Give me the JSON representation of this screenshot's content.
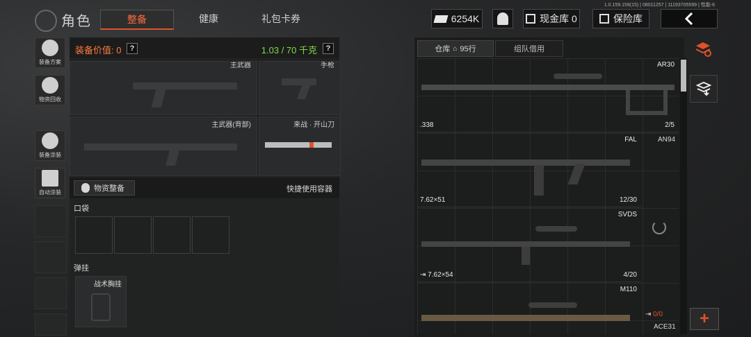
{
  "header": {
    "title": "角色",
    "tabs": [
      {
        "label": "整备",
        "active": true
      },
      {
        "label": "健康",
        "active": false
      },
      {
        "label": "礼包卡券",
        "active": false
      }
    ],
    "version": "1.0.159.159(15) | 08011257 | 11193705599 | 性能-6",
    "currency": "6254K",
    "cash_vault_label": "现金库 0",
    "safe_label": "保险库"
  },
  "sidebar": {
    "items": [
      {
        "label": "装备方案",
        "icon": "helmet-icon"
      },
      {
        "label": "物资回收",
        "icon": "recycle-icon"
      },
      {
        "label": "装备涂装",
        "icon": "mask-icon"
      },
      {
        "label": "自动涂装",
        "icon": "spray-icon"
      }
    ]
  },
  "loadout": {
    "value_label": "装备价值: 0",
    "weight_label": "1.03 / 70 千克",
    "slots": {
      "primary": "主武器",
      "pistol": "手枪",
      "primary_back": "主武器(背部)",
      "melee": "来战 · 开山刀"
    },
    "supply_button": "物资整备",
    "quick_container": "快捷使用容器",
    "pocket_label": "口袋",
    "rig_label": "弹挂",
    "rig_item": "战术胸挂"
  },
  "storage": {
    "tab_warehouse": "仓库",
    "warehouse_rows": "95行",
    "tab_team": "组队借用",
    "weapons": [
      {
        "name": "AR30",
        "ammo": ".338",
        "count": "2/5"
      },
      {
        "name": "FAL",
        "ammo": "7.62×51",
        "count": "12/30"
      },
      {
        "name": "SVDS",
        "ammo": "7.62×54",
        "count": "4/20"
      },
      {
        "name": "M110",
        "ammo": "",
        "count": ""
      }
    ],
    "side_items": [
      {
        "name": "AN94"
      },
      {
        "name": "ACE31",
        "count": "0/0"
      }
    ]
  },
  "colors": {
    "accent": "#e0512a",
    "weight_green": "#7ddc4a",
    "value_orange": "#ff7a3c"
  }
}
